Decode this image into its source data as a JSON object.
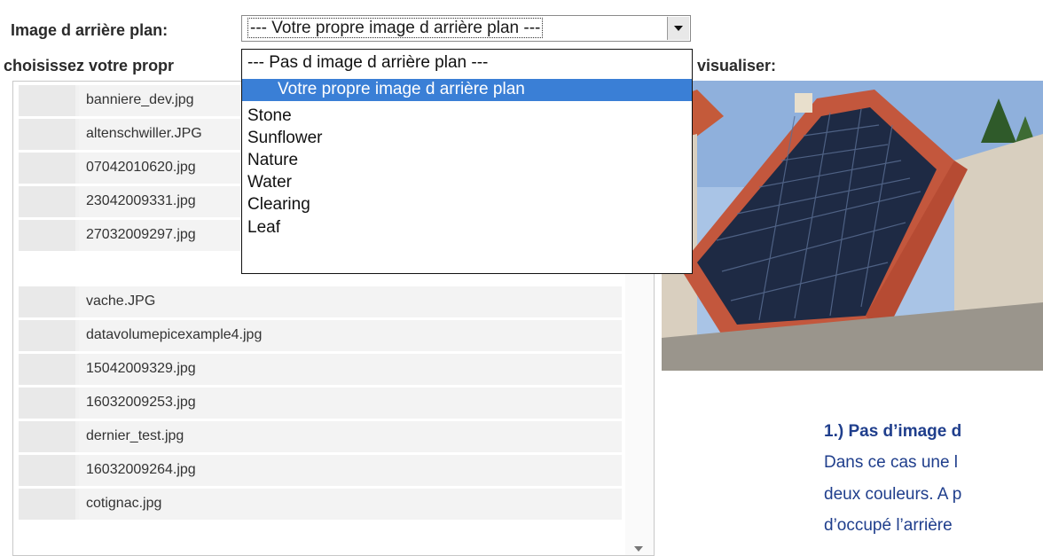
{
  "background": {
    "label": "Image d arrière plan:",
    "selected_value": "--- Votre propre image d arrière plan ---",
    "options": [
      "--- Pas d image d arrière plan ---",
      "Votre propre image d arrière plan",
      "Stone",
      "Sunflower",
      "Nature",
      "Water",
      "Clearing",
      "Leaf"
    ],
    "highlighted_index": 1
  },
  "choose_label": "choisissez votre propr",
  "preview_label": "visualiser:",
  "files": [
    "banniere_dev.jpg",
    "altenschwiller.JPG",
    "07042010620.jpg",
    "23042009331.jpg",
    "27032009297.jpg",
    "vache.JPG",
    "datavolumepicexample4.jpg",
    "15042009329.jpg",
    "16032009253.jpg",
    "dernier_test.jpg",
    "16032009264.jpg",
    "cotignac.jpg"
  ],
  "caption": {
    "heading": "1.) Pas d’image d",
    "lines": [
      "Dans ce cas une l",
      "deux couleurs. A p",
      "d’occupé l’arrière"
    ]
  },
  "colors": {
    "highlight": "#3a7fd6",
    "caption": "#1f3e8c"
  }
}
